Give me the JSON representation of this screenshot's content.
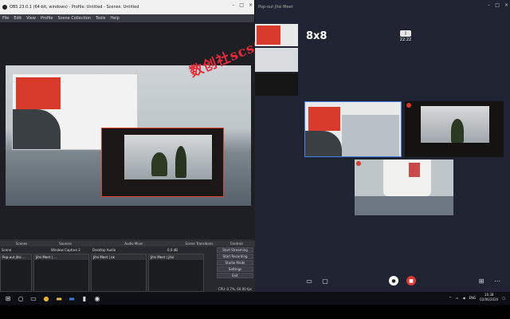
{
  "obs": {
    "title": "OBS 23.0.1 (64-bit, windows) - Profile: Untitled - Scenes: Untitled",
    "menu": [
      "File",
      "Edit",
      "View",
      "Profile",
      "Scene Collection",
      "Tools",
      "Help"
    ],
    "watermark": "数创社scs66",
    "dock_headers": [
      "Scenes",
      "Sources",
      "Audio Mixer",
      "Scene Transitions",
      "Controls"
    ],
    "scene_name": "Scene",
    "source_name": "Window Capture 2",
    "audio_name": "Desktop Audio",
    "audio_level": "0.0 dB",
    "thumbnails": [
      "Pop-out Jitsi ...",
      "Jitsi Meet | ...",
      "Jitsi Meet | ok",
      "Jitsi Meet | jitsi"
    ],
    "controls": [
      "Start Streaming",
      "Start Recording",
      "Studio Mode",
      "Settings",
      "Exit"
    ],
    "status": "CPU: 0.7%, 60.00 fps"
  },
  "meet": {
    "title": "Pop-out Jitsi Meet",
    "room_name": "8x8",
    "timer": "22:22"
  },
  "taskbar": {
    "lang": "ENG",
    "time": "16:38",
    "date": "02/06/2020"
  }
}
